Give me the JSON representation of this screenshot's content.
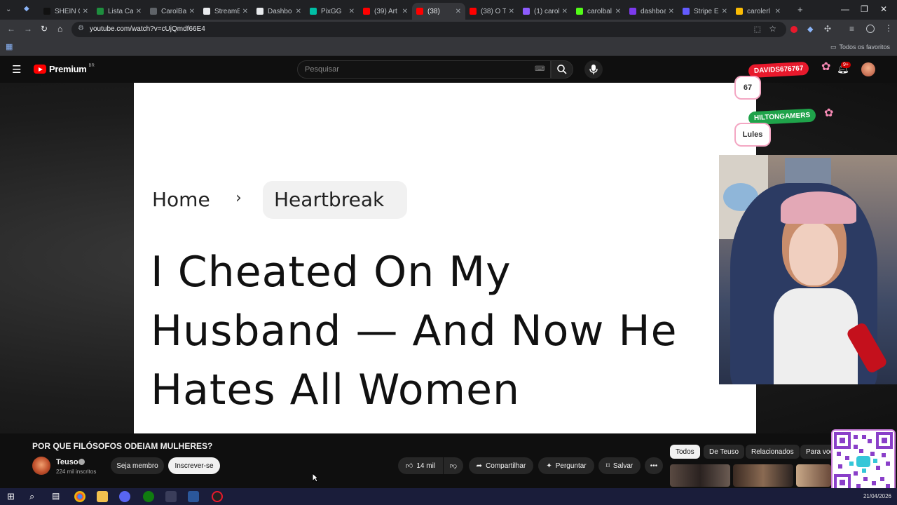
{
  "browser": {
    "tabs": [
      {
        "label": "SHEIN C",
        "color": "#111111"
      },
      {
        "label": "Lista Ca",
        "color": "#1e8e3e"
      },
      {
        "label": "CarolBal",
        "color": "#5f6368"
      },
      {
        "label": "StreamE",
        "color": "#e8eaed"
      },
      {
        "label": "Dashbo",
        "color": "#e8eaed"
      },
      {
        "label": "PixGG",
        "color": "#00bfa5"
      },
      {
        "label": "(39) Art",
        "color": "#ff0000"
      },
      {
        "label": "(38)",
        "color": "#ff0000",
        "active": true
      },
      {
        "label": "(38) O T",
        "color": "#ff0000"
      },
      {
        "label": "(1) carol",
        "color": "#8e5cff"
      },
      {
        "label": "carolbal",
        "color": "#53fc18"
      },
      {
        "label": "dashboar",
        "color": "#7c3aed"
      },
      {
        "label": "Stripe E",
        "color": "#635bff"
      },
      {
        "label": "carolerl",
        "color": "#fbbc04"
      }
    ],
    "url": "youtube.com/watch?v=cUjQmdf66E4",
    "bookmarks_label": "Todos os favoritos"
  },
  "youtube": {
    "brand": "Premium",
    "country": "BR",
    "search_placeholder": "Pesquisar",
    "notification_badge": "9+"
  },
  "video": {
    "breadcrumb_home": "Home",
    "breadcrumb_category": "Heartbreak",
    "headline": "I Cheated On My\nHusband — And Now He\nHates All Women"
  },
  "overlay": {
    "badge1": {
      "label": "DAVIDS676767",
      "color": "#e8192c"
    },
    "bubble1": "67",
    "badge2": {
      "label": "HILTONGAMERS",
      "color": "#1fa34a"
    },
    "bubble2": "Lules"
  },
  "below": {
    "title": "POR QUE FILÓSOFOS ODEIAM MULHERES?",
    "channel": "Teuso",
    "subscribers": "224 mil inscritos",
    "member_button": "Seja membro",
    "subscribe_button": "Inscrever-se",
    "likes": "14 mil",
    "share": "Compartilhar",
    "ask": "Perguntar",
    "save": "Salvar",
    "chips": [
      "Todos",
      "De Teuso",
      "Relacionados",
      "Para voc"
    ]
  },
  "taskbar": {
    "date": "21/04/2026"
  }
}
